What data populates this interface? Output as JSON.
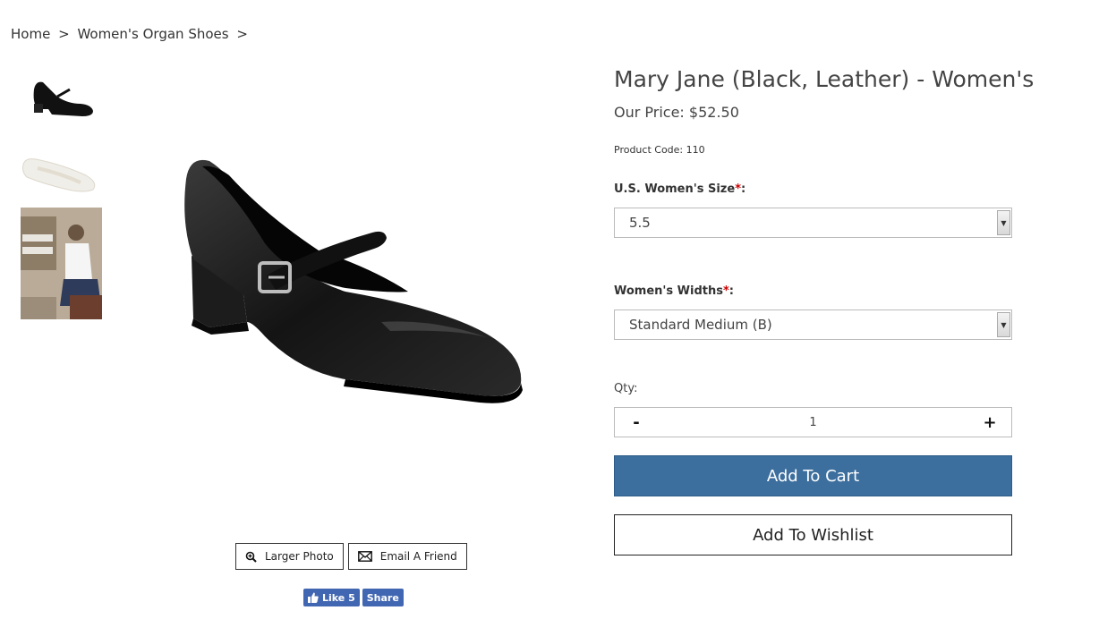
{
  "breadcrumb": {
    "home": "Home",
    "separator": ">",
    "category": "Women's Organ Shoes"
  },
  "product": {
    "title": "Mary Jane (Black, Leather) - Women's",
    "price": "Our Price: $52.50",
    "code": "Product Code: 110"
  },
  "options": {
    "size_label": "U.S. Women's Size",
    "size_value": "5.5",
    "width_label": "Women's Widths",
    "width_value": "Standard Medium (B)",
    "required_mark": "*",
    "colon": ":"
  },
  "quantity": {
    "label": "Qty:",
    "value": "1",
    "minus": "-",
    "plus": "+"
  },
  "actions": {
    "add_to_cart": "Add To Cart",
    "add_to_wishlist": "Add To Wishlist"
  },
  "image_buttons": {
    "larger_photo": "Larger Photo",
    "email_friend": "Email A Friend"
  },
  "social": {
    "like": "Like 5",
    "share": "Share"
  },
  "icons": {
    "zoom": "zoom-icon",
    "email": "envelope-icon",
    "thumbs_up": "thumbs-up-icon",
    "dropdown": "chevron-down-icon"
  },
  "colors": {
    "cart_button": "#3d6f9e",
    "facebook": "#4267b2",
    "required": "#cc0000"
  }
}
